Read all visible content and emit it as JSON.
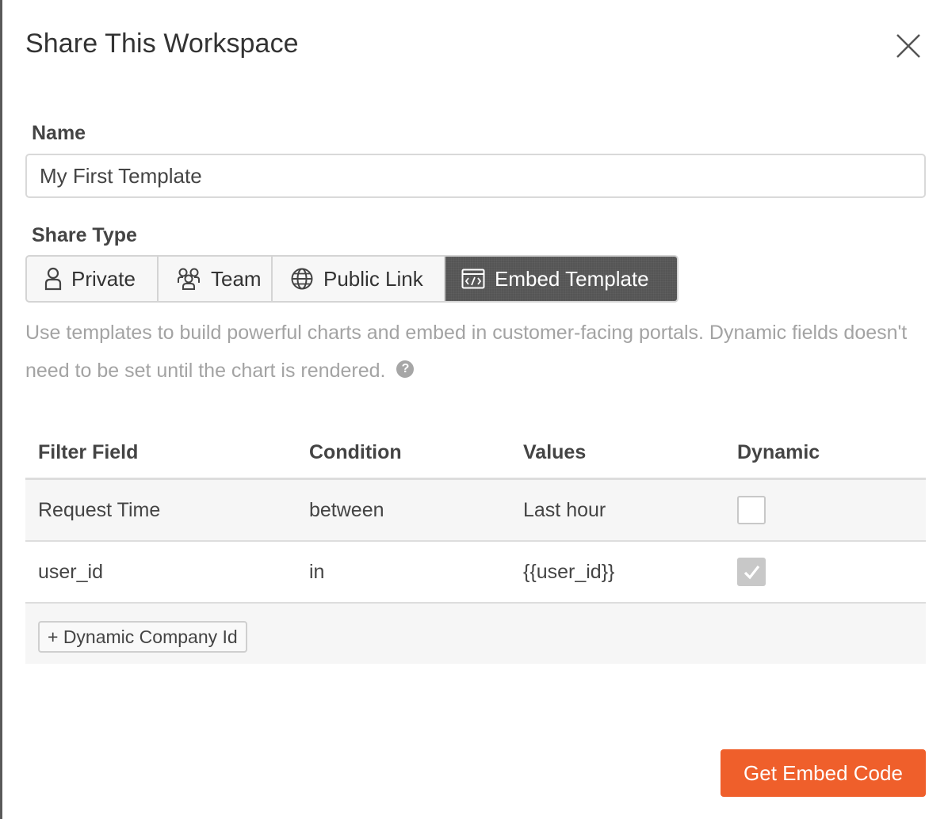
{
  "dialog": {
    "title": "Share This Workspace",
    "close_icon": "close-icon"
  },
  "name_field": {
    "label": "Name",
    "value": "My First Template"
  },
  "share_type": {
    "label": "Share Type",
    "options": [
      {
        "label": "Private",
        "icon": "user-icon",
        "selected": false
      },
      {
        "label": "Team",
        "icon": "team-icon",
        "selected": false
      },
      {
        "label": "Public Link",
        "icon": "globe-icon",
        "selected": false
      },
      {
        "label": "Embed Template",
        "icon": "embed-code-icon",
        "selected": true
      }
    ],
    "help_text": "Use templates to build powerful charts and embed in customer-facing portals. Dynamic fields doesn't need to be set until the chart is rendered.",
    "help_icon": "?"
  },
  "filters": {
    "headers": [
      "Filter Field",
      "Condition",
      "Values",
      "Dynamic"
    ],
    "rows": [
      {
        "field": "Request Time",
        "condition": "between",
        "values": "Last hour",
        "dynamic": false
      },
      {
        "field": "user_id",
        "condition": "in",
        "values": "{{user_id}}",
        "dynamic": true
      }
    ],
    "add_label": "+ Dynamic Company Id"
  },
  "actions": {
    "primary_label": "Get Embed Code",
    "primary_color": "#ef5f2b"
  }
}
